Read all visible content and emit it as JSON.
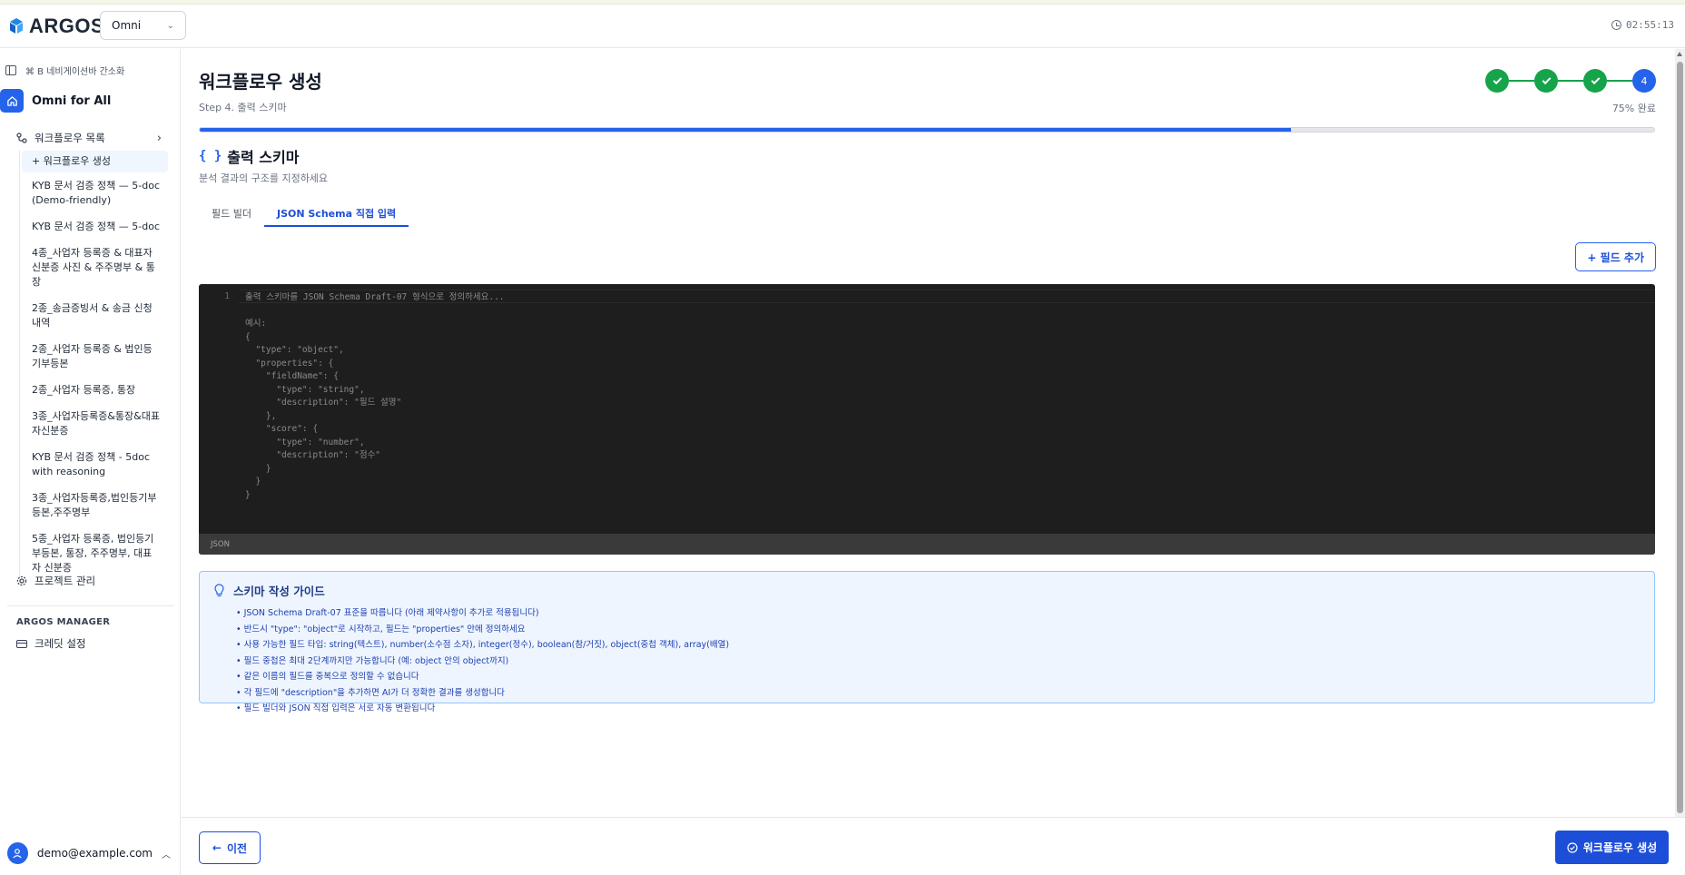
{
  "app": {
    "logo_text": "ARGOS",
    "org_select": "Omni",
    "clock": "02:55:13"
  },
  "sidebar": {
    "shortcut_text": "⌘ B 네비게이션바 간소화",
    "project_name": "Omni for All",
    "workflow_list_label": "워크플로우 목록",
    "workflows": [
      "+ 워크플로우 생성",
      "KYB 문서 검증 정책 — 5-doc (Demo-friendly)",
      "KYB 문서 검증 정책 — 5-doc",
      "4종_사업자 등록증 & 대표자 신분증 사진 & 주주명부 & 통장",
      "2종_송금증빙서 & 송금 신청 내역",
      "2종_사업자 등록증 & 법인등기부등본",
      "2종_사업자 등록증, 통장",
      "3종_사업자등록증&통장&대표자신분증",
      "KYB 문서 검증 정책 - 5doc with reasoning",
      "3종_사업자등록증,법인등기부등본,주주명부",
      "5종_사업자 등록증, 법인등기부등본, 통장, 주주명부, 대표자 신분증"
    ],
    "project_mgmt": "프로젝트 관리",
    "manager_label": "ARGOS MANAGER",
    "credit_settings": "크레딧 설정",
    "user_email": "demo@example.com"
  },
  "main": {
    "title": "워크플로우 생성",
    "step_subtitle": "Step 4. 출력 스키마",
    "steps": [
      "1",
      "2",
      "3",
      "4"
    ],
    "current_step": "4",
    "progress_label": "75% 완료",
    "progress_value": 0.75,
    "section_title": "출력 스키마",
    "section_icon": "{ }",
    "section_subtitle": "분석 결과의 구조를 지정하세요",
    "tabs": [
      "필드 빌더",
      "JSON Schema 직접 입력"
    ],
    "active_tab": 1,
    "add_field_label": "+ 필드 추가",
    "editor": {
      "line_number": "1",
      "placeholder": "출력 스키마를 JSON Schema Draft-07 형식으로 정의하세요...\n\n예시:\n{\n  \"type\": \"object\",\n  \"properties\": {\n    \"fieldName\": {\n      \"type\": \"string\",\n      \"description\": \"필드 설명\"\n    },\n    \"score\": {\n      \"type\": \"number\",\n      \"description\": \"점수\"\n    }\n  }\n}",
      "language": "JSON"
    },
    "guide": {
      "title": "스키마 작성 가이드",
      "items": [
        "• JSON Schema Draft-07 표준을 따릅니다 (아래 제약사항이 추가로 적용됩니다)",
        "• 반드시 \"type\": \"object\"로 시작하고, 필드는 \"properties\" 안에 정의하세요",
        "• 사용 가능한 필드 타입: string(텍스트), number(소수점 소자), integer(정수), boolean(참/거짓), object(중첩 객체), array(배열)",
        "• 필드 중첩은 최대 2단계까지만 가능합니다 (예: object 안의 object까지)",
        "• 같은 이름의 필드를 중복으로 정의할 수 없습니다",
        "• 각 필드에 \"description\"을 추가하면 AI가 더 정확한 결과를 생성합니다",
        "• 필드 빌더와 JSON 직접 입력은 서로 자동 변환됩니다"
      ]
    }
  },
  "footer": {
    "prev_label": "이전",
    "create_label": "워크플로우 생성"
  },
  "colors": {
    "primary": "#1d4ed8",
    "accent_blue": "#2563eb",
    "success": "#16a34a",
    "editor_bg": "#1e1e1e",
    "guide_bg": "#eef5ff"
  }
}
